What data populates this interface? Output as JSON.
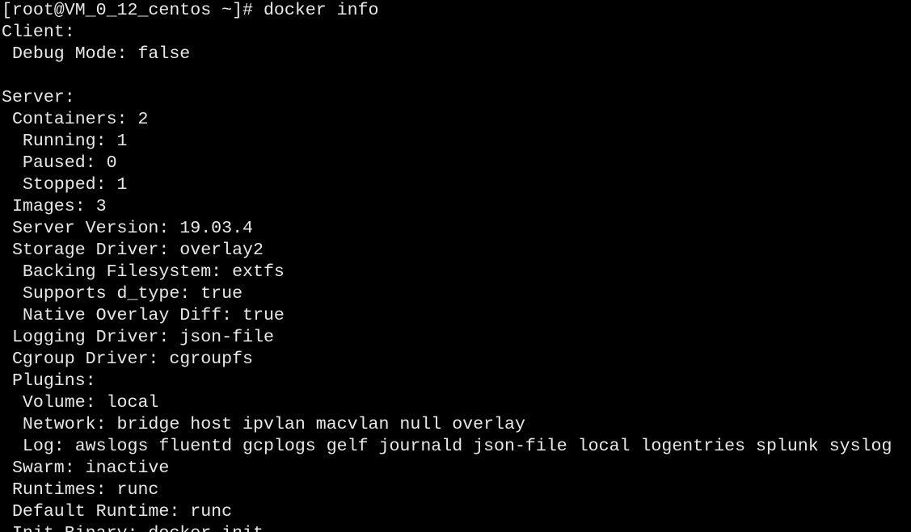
{
  "terminal": {
    "lines": [
      "[root@VM_0_12_centos ~]# docker info",
      "Client:",
      " Debug Mode: false",
      "",
      "Server:",
      " Containers: 2",
      "  Running: 1",
      "  Paused: 0",
      "  Stopped: 1",
      " Images: 3",
      " Server Version: 19.03.4",
      " Storage Driver: overlay2",
      "  Backing Filesystem: extfs",
      "  Supports d_type: true",
      "  Native Overlay Diff: true",
      " Logging Driver: json-file",
      " Cgroup Driver: cgroupfs",
      " Plugins:",
      "  Volume: local",
      "  Network: bridge host ipvlan macvlan null overlay",
      "  Log: awslogs fluentd gcplogs gelf journald json-file local logentries splunk syslog",
      " Swarm: inactive",
      " Runtimes: runc",
      " Default Runtime: runc",
      " Init Binary: docker-init"
    ]
  },
  "colors": {
    "background": "#000000",
    "foreground": "#e8e8e8"
  }
}
